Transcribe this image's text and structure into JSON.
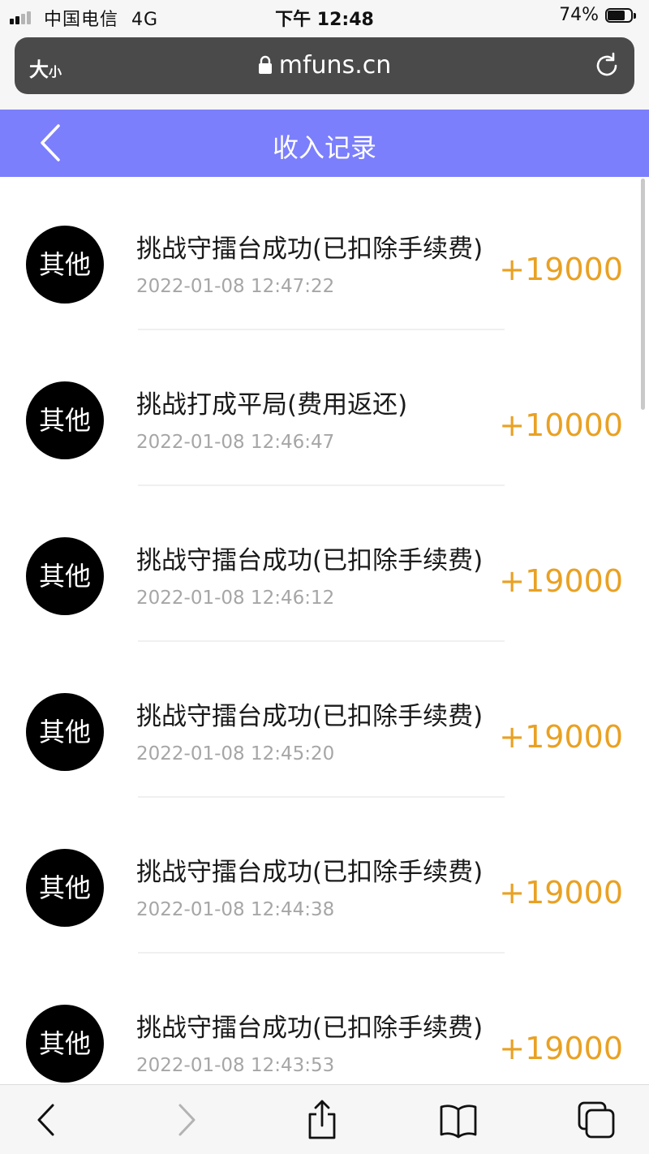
{
  "status_bar": {
    "carrier": "中国电信",
    "network": "4G",
    "time": "下午 12:48",
    "battery": "74%",
    "battery_level": 0.74
  },
  "browser": {
    "text_size_big": "大",
    "text_size_small": "小",
    "url": "mfuns.cn"
  },
  "header": {
    "title": "收入记录"
  },
  "records": [
    {
      "icon_label": "其他",
      "title": "挑战守擂台成功(已扣除手续费)",
      "time": "2022-01-08 12:47:22",
      "amount": "+19000"
    },
    {
      "icon_label": "其他",
      "title": "挑战打成平局(费用返还)",
      "time": "2022-01-08 12:46:47",
      "amount": "+10000"
    },
    {
      "icon_label": "其他",
      "title": "挑战守擂台成功(已扣除手续费)",
      "time": "2022-01-08 12:46:12",
      "amount": "+19000"
    },
    {
      "icon_label": "其他",
      "title": "挑战守擂台成功(已扣除手续费)",
      "time": "2022-01-08 12:45:20",
      "amount": "+19000"
    },
    {
      "icon_label": "其他",
      "title": "挑战守擂台成功(已扣除手续费)",
      "time": "2022-01-08 12:44:38",
      "amount": "+19000"
    },
    {
      "icon_label": "其他",
      "title": "挑战守擂台成功(已扣除手续费)",
      "time": "2022-01-08 12:43:53",
      "amount": "+19000"
    }
  ],
  "colors": {
    "header_bg": "#7b7ffc",
    "amount": "#e9a123",
    "time_text": "#a6a6a6",
    "avatar_bg": "#000000"
  },
  "icons": {
    "back": "chevron-left-icon",
    "lock": "lock-icon",
    "reload": "reload-icon",
    "toolbar": [
      "browser-back-icon",
      "browser-forward-icon",
      "share-icon",
      "bookmarks-icon",
      "tabs-icon"
    ]
  }
}
